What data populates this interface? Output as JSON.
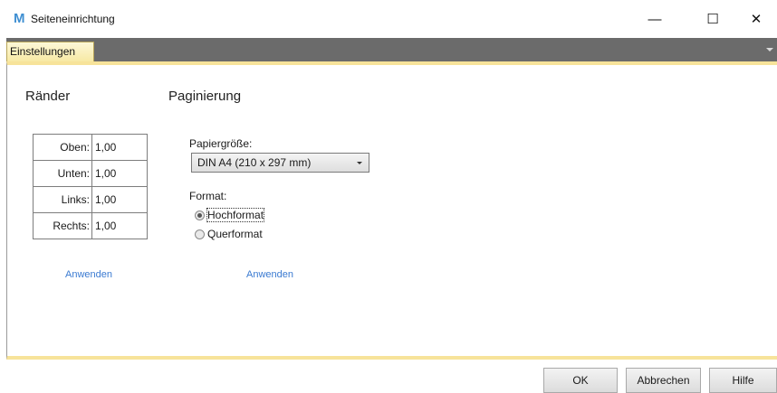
{
  "window": {
    "title": "Seiteneinrichtung",
    "app_icon": "M",
    "controls": {
      "minimize": "—",
      "maximize": "☐",
      "close": "✕"
    }
  },
  "tabs": [
    {
      "label": "Einstellungen",
      "active": true
    }
  ],
  "raender": {
    "heading": "Ränder",
    "rows": [
      {
        "label": "Oben:",
        "value": "1,00"
      },
      {
        "label": "Unten:",
        "value": "1,00"
      },
      {
        "label": "Links:",
        "value": "1,00"
      },
      {
        "label": "Rechts:",
        "value": "1,00"
      }
    ],
    "apply": "Anwenden"
  },
  "paginierung": {
    "heading": "Paginierung",
    "paper_label": "Papiergröße:",
    "paper_value": "DIN A4 (210 x 297 mm)",
    "format_label": "Format:",
    "options": [
      {
        "label": "Hochformat",
        "checked": true
      },
      {
        "label": "Querformat",
        "checked": false
      }
    ],
    "apply": "Anwenden"
  },
  "buttons": {
    "ok": "OK",
    "cancel": "Abbrechen",
    "help": "Hilfe"
  },
  "colors": {
    "accent_yellow": "#f7e39a",
    "link": "#3a7ad1",
    "tab_band": "#6b6b6b",
    "app_icon": "#3f8fd2"
  }
}
